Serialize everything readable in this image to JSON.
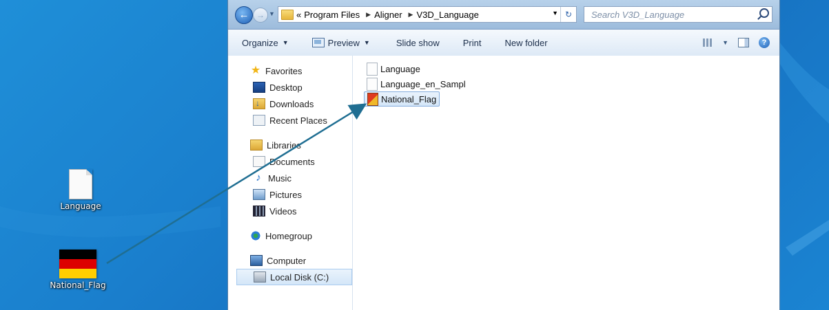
{
  "desktop": {
    "icons": [
      {
        "label": "Language"
      },
      {
        "label": "National_Flag"
      }
    ],
    "flag_colors": [
      "#000000",
      "#dd0000",
      "#ffce00"
    ]
  },
  "window": {
    "address": {
      "overflow_glyph": "«",
      "crumbs": [
        "Program Files",
        "Aligner",
        "V3D_Language"
      ],
      "search_placeholder": "Search V3D_Language"
    },
    "toolbar": {
      "organize": "Organize",
      "preview": "Preview",
      "slideshow": "Slide show",
      "print": "Print",
      "new_folder": "New folder"
    },
    "nav": {
      "favorites": {
        "label": "Favorites",
        "items": [
          "Desktop",
          "Downloads",
          "Recent Places"
        ]
      },
      "libraries": {
        "label": "Libraries",
        "items": [
          "Documents",
          "Music",
          "Pictures",
          "Videos"
        ]
      },
      "homegroup": "Homegroup",
      "computer": {
        "label": "Computer",
        "items": [
          "Local Disk (C:)"
        ]
      }
    },
    "files": [
      {
        "name": "Language",
        "icon": "text-file-icon"
      },
      {
        "name": "Language_en_Sampl",
        "icon": "text-file-icon"
      },
      {
        "name": "National_Flag",
        "icon": "image-file-icon",
        "selected": true
      }
    ]
  },
  "annotation": {
    "arrow_color": "#1f6e92"
  }
}
